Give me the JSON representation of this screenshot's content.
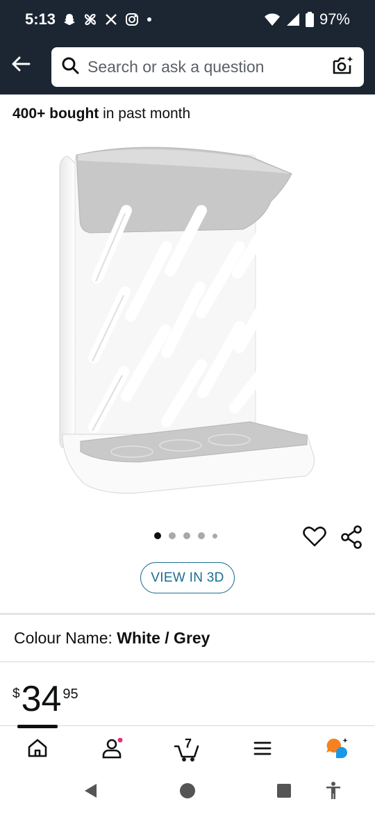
{
  "status_bar": {
    "time": "5:13",
    "battery": "97%",
    "icons": [
      "snapchat-icon",
      "pinwheel-icon",
      "x-icon",
      "instagram-icon",
      "dot-icon",
      "wifi-icon",
      "signal-icon",
      "battery-icon"
    ]
  },
  "header": {
    "back_icon": "back-arrow-icon",
    "search_placeholder": "Search or ask a question",
    "camera_icon": "camera-sparkle-icon"
  },
  "product": {
    "bought_count": "400+ bought",
    "bought_suffix": " in past month",
    "image_name": "bottle-drying-rack",
    "image_dots": {
      "count": 5,
      "active_index": 0
    },
    "view_3d_label": "VIEW IN 3D",
    "colour_label": "Colour Name: ",
    "colour_value": "White / Grey",
    "price": {
      "currency": "$",
      "whole": "34",
      "fraction": "95"
    }
  },
  "bottom_nav": {
    "items": [
      "home-icon",
      "account-icon",
      "cart-icon",
      "menu-icon",
      "rufus-icon"
    ],
    "cart_count": "7",
    "active_index": 0
  },
  "system_nav": [
    "back-triangle-icon",
    "home-circle-icon",
    "recents-square-icon",
    "accessibility-icon"
  ],
  "colors": {
    "header": "#1b2632",
    "link": "#1a6e8f",
    "notification": "#e4317b",
    "rufus_orange": "#f5821f",
    "rufus_blue": "#1a98e6"
  }
}
